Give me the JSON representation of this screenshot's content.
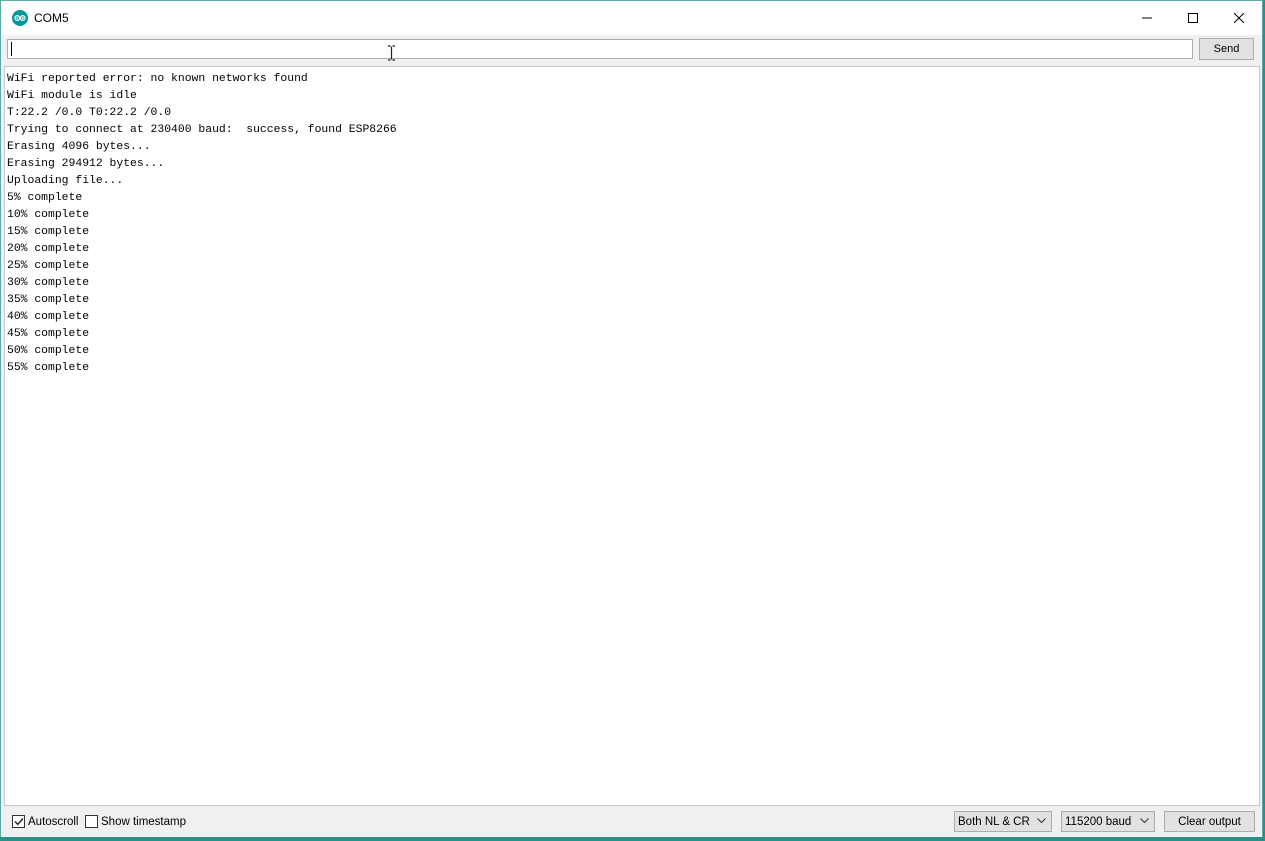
{
  "window": {
    "title": "COM5",
    "app_icon": "arduino-icon",
    "controls": [
      "minimize-icon",
      "maximize-icon",
      "close-icon"
    ]
  },
  "input": {
    "value": "",
    "placeholder": "",
    "send_label": "Send"
  },
  "output": {
    "lines": [
      "WiFi reported error: no known networks found",
      "WiFi module is idle",
      "T:22.2 /0.0 T0:22.2 /0.0",
      "Trying to connect at 230400 baud:  success, found ESP8266",
      "Erasing 4096 bytes...",
      "Erasing 294912 bytes...",
      "Uploading file...",
      "5% complete",
      "10% complete",
      "15% complete",
      "20% complete",
      "25% complete",
      "30% complete",
      "35% complete",
      "40% complete",
      "45% complete",
      "50% complete",
      "55% complete"
    ]
  },
  "statusbar": {
    "autoscroll_label": "Autoscroll",
    "autoscroll_checked": true,
    "timestamp_label": "Show timestamp",
    "timestamp_checked": false,
    "line_ending": "Both NL & CR",
    "baud_rate": "115200 baud",
    "clear_label": "Clear output"
  },
  "colors": {
    "accent": "#00979d",
    "background": "#f0f0f0"
  }
}
